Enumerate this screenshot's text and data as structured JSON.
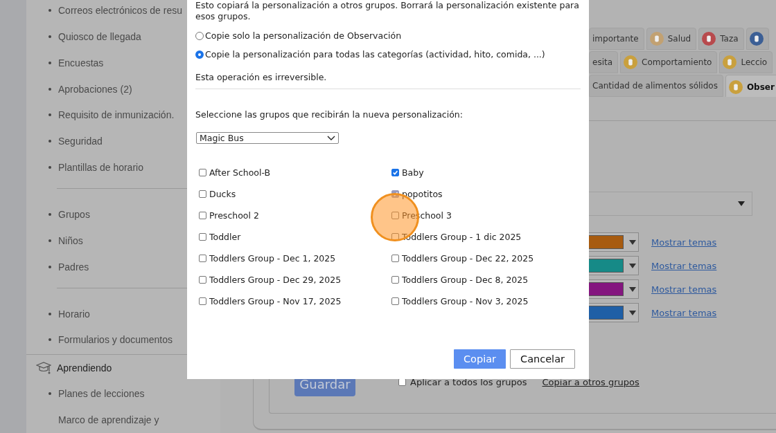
{
  "sidebar": {
    "items": [
      {
        "label": "Correos electrónicos de resu",
        "kind": "item"
      },
      {
        "label": "Quiosco de llegada",
        "kind": "item"
      },
      {
        "label": "Encuestas",
        "kind": "item"
      },
      {
        "label": "Aprobaciones (2)",
        "kind": "item"
      },
      {
        "label": "Requisito de inmunización.",
        "kind": "item"
      },
      {
        "label": "Seguridad",
        "kind": "item"
      },
      {
        "label": "Plantillas de horario",
        "kind": "item"
      },
      {
        "kind": "divider"
      },
      {
        "label": "Grupos",
        "kind": "item"
      },
      {
        "label": "Niños",
        "kind": "item"
      },
      {
        "label": "Padres",
        "kind": "item"
      },
      {
        "kind": "divider"
      },
      {
        "label": "Horario",
        "kind": "item"
      },
      {
        "label": "Formularios y documentos",
        "kind": "item"
      },
      {
        "label": "Aprendiendo",
        "kind": "section"
      },
      {
        "label": "Planes de lecciones",
        "kind": "item"
      },
      {
        "label": "Marco de aprendizaje y",
        "kind": "plain"
      }
    ]
  },
  "tab_rows": [
    [
      {
        "label": "importante",
        "selected": false
      },
      {
        "label": "Salud",
        "color": "#c2a172",
        "selected": false
      },
      {
        "label": "Taza",
        "color": "#b84a4d",
        "selected": false
      },
      {
        "color": "#3c5f95",
        "selected": false
      }
    ],
    [
      {
        "label": "esita",
        "selected": false
      },
      {
        "label": "Comportamiento",
        "color": "#c9a03e",
        "selected": false
      },
      {
        "label": "Leccio",
        "color": "#c9a03e",
        "selected": false
      }
    ],
    [
      {
        "label": "Cantidad de alimentos sólidos",
        "selected": false
      },
      {
        "label": "Obser",
        "color": "#c9a03e",
        "selected": true
      }
    ]
  ],
  "color_rows": [
    {
      "color": "#a75b10",
      "link": "Mostrar temas"
    },
    {
      "color": "#168a87",
      "link": "Mostrar temas"
    },
    {
      "color": "#84167f",
      "link": "Mostrar temas"
    },
    {
      "color": "#1f5fa6",
      "link": "Mostrar temas"
    }
  ],
  "footer": {
    "save_button": "Guardar",
    "apply_all": {
      "label": "Aplicar a todos los grupos",
      "checked": false
    },
    "copy_link": "Copiar a otros grupos"
  },
  "dialog": {
    "intro": "Esto copiará la personalización a otros grupos. Borrará la personalización existente para esos grupos.",
    "options": [
      {
        "label": "Copie solo la personalización de Observación",
        "selected": false
      },
      {
        "label": "Copie la personalización para todas las categorías (actividad, hito, comida, ...)",
        "selected": true
      }
    ],
    "warning": "Esta operación es irreversible.",
    "select_prompt": "Seleccione las grupos que recibirán la nueva personalización:",
    "select_value": "Magic Bus",
    "groups": [
      {
        "label": "After School-B",
        "checked": false
      },
      {
        "label": "Baby",
        "checked": true
      },
      {
        "label": "Ducks",
        "checked": false
      },
      {
        "label": "popotitos",
        "checked": true,
        "disabled": true
      },
      {
        "label": "Preschool 2",
        "checked": false
      },
      {
        "label": "Preschool 3",
        "checked": false
      },
      {
        "label": "Toddler",
        "checked": false
      },
      {
        "label": "Toddlers Group - 1 dic 2025",
        "checked": false
      },
      {
        "label": "Toddlers Group - Dec 1, 2025",
        "checked": false
      },
      {
        "label": "Toddlers Group - Dec 22, 2025",
        "checked": false
      },
      {
        "label": "Toddlers Group - Dec 29, 2025",
        "checked": false
      },
      {
        "label": "Toddlers Group - Dec 8, 2025",
        "checked": false
      },
      {
        "label": "Toddlers Group - Nov 17, 2025",
        "checked": false
      },
      {
        "label": "Toddlers Group - Nov 3, 2025",
        "checked": false
      }
    ],
    "buttons": [
      {
        "label": "Copiar",
        "kind": "primary"
      },
      {
        "label": "Cancelar",
        "kind": "secondary"
      }
    ]
  }
}
